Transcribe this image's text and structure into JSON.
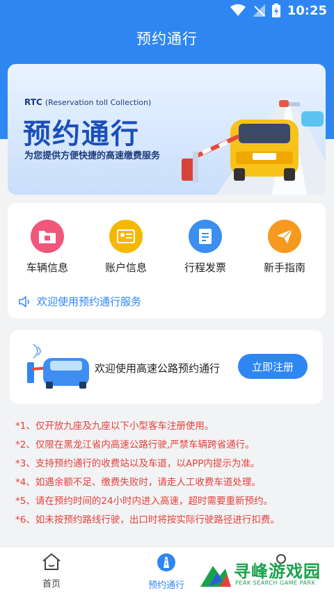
{
  "status": {
    "time": "10:25"
  },
  "header": {
    "title": "预约通行"
  },
  "banner": {
    "rtc": "RTC",
    "rtc_full": "(Reservation toll Collection)",
    "title": "预约通行",
    "subtitle": "为您提供方便快捷的高速缴费服务"
  },
  "menu": {
    "items": [
      {
        "label": "车辆信息",
        "icon": "vehicle-info-icon",
        "color": "#f0577b"
      },
      {
        "label": "账户信息",
        "icon": "account-card-icon",
        "color": "#f5b800"
      },
      {
        "label": "行程发票",
        "icon": "invoice-icon",
        "color": "#3a8ff0"
      },
      {
        "label": "新手指南",
        "icon": "paper-plane-icon",
        "color": "#f59a1f"
      }
    ],
    "notice": "欢迎使用预约通行服务"
  },
  "register": {
    "text": "欢迎使用高速公路预约通行",
    "button": "立即注册"
  },
  "rules": [
    "*1、仅开放九座及九座以下小型客车注册使用。",
    "*2、仅限在黑龙江省内高速公路行驶,严禁车辆跨省通行。",
    "*3、支持预约通行的收费站以及车道，以APP内提示为准。",
    "*4、如遇余额不足、缴费失败时，请走人工收费车道处理。",
    "*5、请在预约时间的24小时内进入高速，超时需要重新预约。",
    "*6、如未按预约路线行驶，出口时将按实际行驶路径进行扣费。"
  ],
  "tabs": [
    {
      "label": "首页",
      "icon": "home-icon"
    },
    {
      "label": "预约通行",
      "icon": "road-icon"
    },
    {
      "label": "",
      "icon": "profile-icon"
    }
  ],
  "watermark": {
    "main": "寻峰游戏园",
    "sub": "PEAK SEARCH GAME PARK"
  },
  "colors": {
    "primary": "#2e86f2",
    "rule_text": "#e5413a",
    "background": "#f2f3f5"
  }
}
